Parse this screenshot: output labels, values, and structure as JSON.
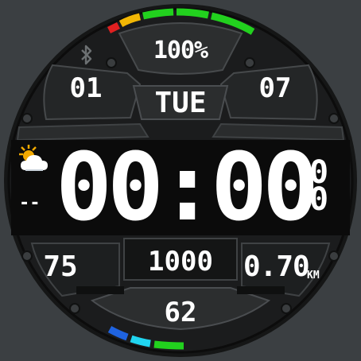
{
  "colors": {
    "background": "#3b3f42",
    "dial": "#151616",
    "panel": "#2b2d2e",
    "text": "#ffffff",
    "bar_red": "#e02020",
    "bar_yellow": "#f2b705",
    "bar_green": "#22d11e",
    "bar_blue": "#1f63e0",
    "bar_cyan": "#20d5f0"
  },
  "icons": {
    "bluetooth": "bluetooth-icon",
    "weather": "partly-cloudy-sun-icon"
  },
  "battery": {
    "value_text": "100%",
    "level_percent": 100
  },
  "date": {
    "month": "01",
    "day": "07",
    "weekday": "TUE"
  },
  "time": {
    "hours_minutes": "00:00",
    "seconds_top": "0",
    "seconds_bottom": "0"
  },
  "weather": {
    "temperature": "--"
  },
  "stats": {
    "heart_rate": "75",
    "steps": "1000",
    "distance": "0.70",
    "distance_unit": "KM",
    "bottom_value": "62"
  }
}
